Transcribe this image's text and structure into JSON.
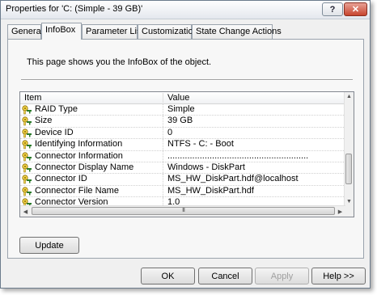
{
  "window": {
    "title": "Properties for 'C: (Simple - 39 GB)'",
    "help_label": "?",
    "close_label": "✕"
  },
  "tabs": [
    {
      "label": "General",
      "active": false
    },
    {
      "label": "InfoBox",
      "active": true
    },
    {
      "label": "Parameter List",
      "active": false
    },
    {
      "label": "Customization",
      "active": false
    },
    {
      "label": "State Change Actions",
      "active": false
    }
  ],
  "infobox": {
    "description": "This page shows you the InfoBox of the object.",
    "columns": {
      "item": "Item",
      "value": "Value"
    },
    "rows": [
      {
        "name": "RAID Type",
        "value": "Simple"
      },
      {
        "name": "Size",
        "value": "39 GB"
      },
      {
        "name": "Device ID",
        "value": "0"
      },
      {
        "name": "Identifying Information",
        "value": "NTFS - C: - Boot"
      },
      {
        "name": "Connector Information",
        "value": "........................................................."
      },
      {
        "name": "Connector Display Name",
        "value": "Windows - DiskPart"
      },
      {
        "name": "Connector ID",
        "value": "MS_HW_DiskPart.hdf@localhost"
      },
      {
        "name": "Connector File Name",
        "value": "MS_HW_DiskPart.hdf"
      },
      {
        "name": "Connector Version",
        "value": "1.0"
      }
    ],
    "icon": "key-icon",
    "scroll_grip": "III",
    "update_label": "Update"
  },
  "footer": {
    "ok_label": "OK",
    "cancel_label": "Cancel",
    "apply_label": "Apply",
    "help_label": "Help >>"
  }
}
